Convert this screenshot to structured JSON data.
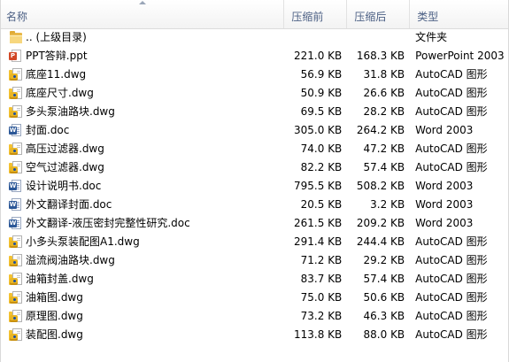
{
  "header": {
    "name": "名称",
    "original_size": "压缩前",
    "compressed_size": "压缩后",
    "type": "类型"
  },
  "rows": [
    {
      "icon": "folder-icon",
      "name": ".. (上级目录)",
      "original": "",
      "compressed": "",
      "type": "文件夹"
    },
    {
      "icon": "ppt-icon",
      "name": "PPT答辩.ppt",
      "original": "221.0 KB",
      "compressed": "168.3 KB",
      "type": "PowerPoint 2003"
    },
    {
      "icon": "dwg-icon",
      "name": "底座11.dwg",
      "original": "56.9 KB",
      "compressed": "31.8 KB",
      "type": "AutoCAD 图形"
    },
    {
      "icon": "dwg-icon",
      "name": "底座尺寸.dwg",
      "original": "50.9 KB",
      "compressed": "26.6 KB",
      "type": "AutoCAD 图形"
    },
    {
      "icon": "dwg-icon",
      "name": "多头泵油路块.dwg",
      "original": "69.5 KB",
      "compressed": "28.2 KB",
      "type": "AutoCAD 图形"
    },
    {
      "icon": "doc-icon",
      "name": "封面.doc",
      "original": "305.0 KB",
      "compressed": "264.2 KB",
      "type": "Word 2003"
    },
    {
      "icon": "dwg-icon",
      "name": "高压过滤器.dwg",
      "original": "74.0 KB",
      "compressed": "47.2 KB",
      "type": "AutoCAD 图形"
    },
    {
      "icon": "dwg-icon",
      "name": "空气过滤器.dwg",
      "original": "82.2 KB",
      "compressed": "57.4 KB",
      "type": "AutoCAD 图形"
    },
    {
      "icon": "doc-icon",
      "name": "设计说明书.doc",
      "original": "795.5 KB",
      "compressed": "508.2 KB",
      "type": "Word 2003"
    },
    {
      "icon": "doc-icon",
      "name": "外文翻译封面.doc",
      "original": "20.5 KB",
      "compressed": "3.2 KB",
      "type": "Word 2003"
    },
    {
      "icon": "doc-icon",
      "name": "外文翻译-液压密封完整性研究.doc",
      "original": "261.5 KB",
      "compressed": "209.2 KB",
      "type": "Word 2003"
    },
    {
      "icon": "dwg-icon",
      "name": "小多头泵装配图A1.dwg",
      "original": "291.4 KB",
      "compressed": "244.4 KB",
      "type": "AutoCAD 图形"
    },
    {
      "icon": "dwg-icon",
      "name": "溢流阀油路块.dwg",
      "original": "71.2 KB",
      "compressed": "29.2 KB",
      "type": "AutoCAD 图形"
    },
    {
      "icon": "dwg-icon",
      "name": "油箱封盖.dwg",
      "original": "83.7 KB",
      "compressed": "57.4 KB",
      "type": "AutoCAD 图形"
    },
    {
      "icon": "dwg-icon",
      "name": "油箱图.dwg",
      "original": "75.0 KB",
      "compressed": "50.6 KB",
      "type": "AutoCAD 图形"
    },
    {
      "icon": "dwg-icon",
      "name": "原理图.dwg",
      "original": "73.2 KB",
      "compressed": "46.3 KB",
      "type": "AutoCAD 图形"
    },
    {
      "icon": "dwg-icon",
      "name": "装配图.dwg",
      "original": "113.8 KB",
      "compressed": "88.0 KB",
      "type": "AutoCAD 图形"
    }
  ]
}
